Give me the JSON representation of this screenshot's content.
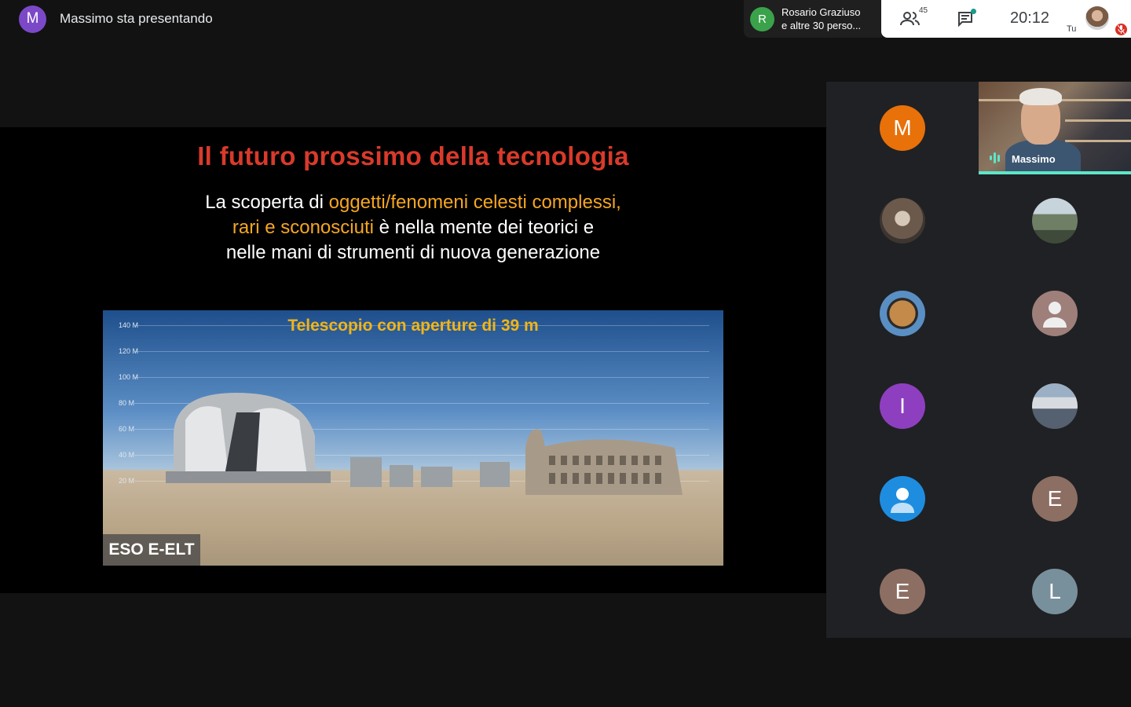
{
  "presenter": {
    "initial": "M",
    "text": "Massimo sta presentando",
    "avatar_color": "#7b49c7"
  },
  "join_notice": {
    "initial": "R",
    "line1": "Rosario Graziuso",
    "line2": "e altre 30 perso...",
    "avatar_color": "#3aa24a"
  },
  "controls": {
    "people_count": "45",
    "people_icon": "people-icon",
    "chat_icon": "chat-icon",
    "clock": "20:12",
    "self_label": "Tu",
    "mic_icon": "mic-off-icon"
  },
  "slide": {
    "title": "Il futuro prossimo della tecnologia",
    "line1_a": "La scoperta di ",
    "line1_b": "oggetti/fenomeni celesti complessi,",
    "line2_a": "rari e sconosciuti",
    "line2_b": " è nella mente dei teorici e",
    "line3": "nelle mani di strumenti di nuova generazione",
    "image_title": "Telescopio con aperture di 39 m",
    "image_caption": "ESO E-ELT",
    "scale_ticks": [
      "140 M",
      "120 M",
      "100 M",
      "80 M",
      "60 M",
      "40 M",
      "20 M"
    ],
    "title_color": "#d93a2b",
    "highlight_color": "#f5a623"
  },
  "participants": {
    "speaker_name": "Massimo",
    "tiles": [
      {
        "initial": "M",
        "color": "#e8710a"
      },
      {
        "initial": "",
        "color": "#6b5a4c"
      },
      {
        "initial": "",
        "color": "#6f7f66"
      },
      {
        "initial": "",
        "color": "#c48a4a"
      },
      {
        "initial": "",
        "color": "#9e7f7a",
        "icon": "person-icon"
      },
      {
        "initial": "I",
        "color": "#8e3fbf"
      },
      {
        "initial": "",
        "color": "#8c9aa8"
      },
      {
        "initial": "",
        "color": "#1e8de0",
        "icon": "person-icon"
      },
      {
        "initial": "E",
        "color": "#8d6e63"
      },
      {
        "initial": "E",
        "color": "#8d6e63"
      },
      {
        "initial": "L",
        "color": "#78909c"
      }
    ]
  }
}
